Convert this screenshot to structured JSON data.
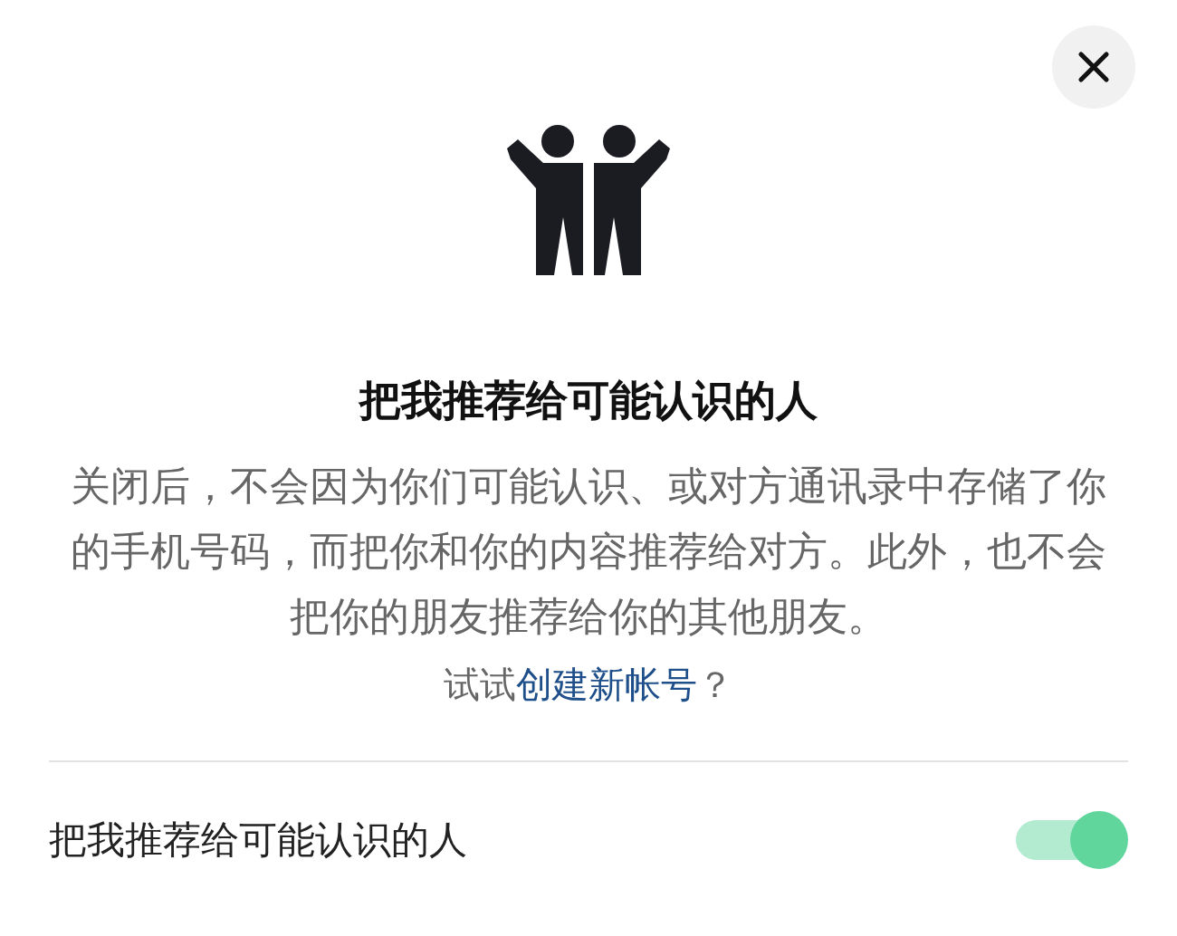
{
  "dialog": {
    "title": "把我推荐给可能认识的人",
    "description": "关闭后，不会因为你们可能认识、或对方通讯录中存储了你的手机号码，而把你和你的内容推荐给对方。此外，也不会把你的朋友推荐给你的其他朋友。",
    "hint": {
      "prefix": "试试",
      "link": "创建新帐号",
      "suffix": "？"
    },
    "setting": {
      "label": "把我推荐给可能认识的人",
      "on": true
    }
  }
}
